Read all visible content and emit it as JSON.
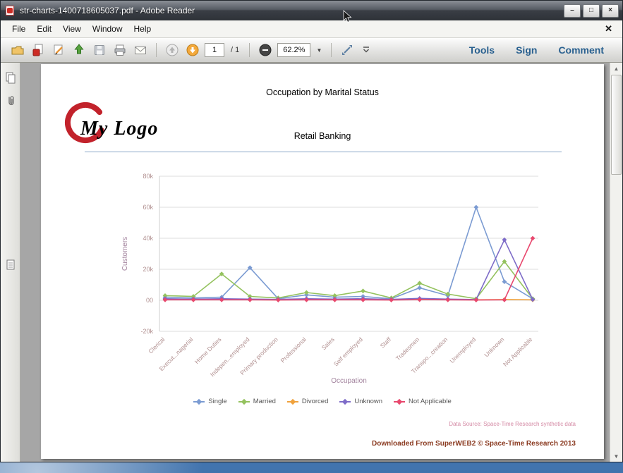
{
  "window": {
    "title": "str-charts-1400718605037.pdf - Adobe Reader",
    "controls": {
      "minimize": "–",
      "maximize": "□",
      "close": "×"
    }
  },
  "menu": {
    "items": [
      "File",
      "Edit",
      "View",
      "Window",
      "Help"
    ],
    "close_label": "✕"
  },
  "toolbar": {
    "page_current": "1",
    "page_total": "/ 1",
    "zoom_value": "62.2%",
    "buttons_right": [
      "Tools",
      "Sign",
      "Comment"
    ],
    "icons": [
      "open-icon",
      "create-pdf-icon",
      "edit-icon",
      "upload-icon",
      "save-icon",
      "print-icon",
      "email-icon",
      "previous-page-icon",
      "next-page-icon",
      "zoom-out-icon",
      "fit-page-icon",
      "toolbar-overflow-icon"
    ]
  },
  "sidebar": {
    "icons": [
      "page-thumbnails-icon",
      "attachments-icon",
      "panel-icon"
    ]
  },
  "page": {
    "title": "Occupation by Marital Status",
    "subtitle": "Retail Banking",
    "logo_text": "My Logo",
    "data_source": "Data Source: Space-Time Research synthetic data",
    "footer": "Downloaded From SuperWEB2 © Space-Time Research 2013"
  },
  "chart_data": {
    "type": "line",
    "title": "Occupation by Marital Status",
    "subtitle": "Retail Banking",
    "xlabel": "Occupation",
    "ylabel": "Customers",
    "ylim": [
      -20000,
      80000
    ],
    "grid": true,
    "legend_position": "bottom",
    "yticks": [
      {
        "value": 80000,
        "label": "80k"
      },
      {
        "value": 60000,
        "label": "60k"
      },
      {
        "value": 40000,
        "label": "40k"
      },
      {
        "value": 20000,
        "label": "20k"
      },
      {
        "value": 0,
        "label": "00"
      },
      {
        "value": -20000,
        "label": "-20k"
      }
    ],
    "categories": [
      "Clerical",
      "Execut...nagerial",
      "Home Duties",
      "Indepen...employed",
      "Primary production",
      "Professional",
      "Sales",
      "Self employed",
      "Staff",
      "Tradesmen",
      "Transpo...creation",
      "Unemployed",
      "Unknown",
      "Not Applicable"
    ],
    "series": [
      {
        "name": "Single",
        "color": "#7b9bd2",
        "values": [
          2000,
          1500,
          2000,
          21000,
          1000,
          3500,
          2000,
          2500,
          1000,
          8000,
          3000,
          60000,
          12000,
          1000
        ]
      },
      {
        "name": "Married",
        "color": "#94c25e",
        "values": [
          3000,
          2500,
          17000,
          2500,
          1500,
          5000,
          3000,
          6000,
          1500,
          11000,
          4000,
          1000,
          25000,
          1000
        ]
      },
      {
        "name": "Divorced",
        "color": "#f0a23c",
        "values": [
          500,
          400,
          500,
          400,
          300,
          500,
          400,
          500,
          300,
          800,
          400,
          300,
          500,
          300
        ]
      },
      {
        "name": "Unknown",
        "color": "#7e6cc8",
        "values": [
          1000,
          800,
          1000,
          800,
          600,
          1000,
          800,
          1000,
          600,
          1200,
          800,
          500,
          39000,
          500
        ]
      },
      {
        "name": "Not Applicable",
        "color": "#e8486e",
        "values": [
          300,
          300,
          300,
          300,
          200,
          300,
          300,
          300,
          200,
          400,
          300,
          200,
          300,
          40000
        ]
      }
    ]
  }
}
